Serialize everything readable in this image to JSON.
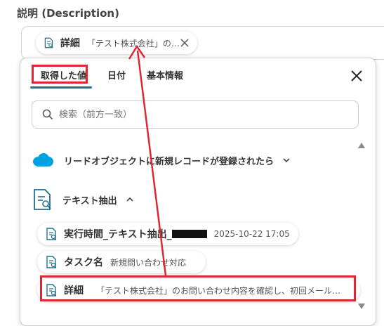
{
  "field": {
    "label": "説明 (Description)"
  },
  "selected_chip": {
    "label": "詳細",
    "value": "「テスト株式会社」の…",
    "icon": "text-extract-icon"
  },
  "panel": {
    "tabs": [
      {
        "label": "取得した値",
        "active": true
      },
      {
        "label": "日付",
        "active": false
      },
      {
        "label": "基本情報",
        "active": false
      }
    ],
    "search": {
      "placeholder": "検索（前方一致）"
    },
    "apps": [
      {
        "label": "リードオブジェクトに新規レコードが登録されたら",
        "icon": "salesforce-cloud-icon",
        "expanded": false
      },
      {
        "label": "テキスト抽出",
        "icon": "text-extract-icon",
        "expanded": true
      }
    ],
    "items": [
      {
        "label": "実行時間_テキスト抽出_",
        "value": "2025-10-22 17:05",
        "redacted": true
      },
      {
        "label": "タスク名",
        "value": "新規問い合わせ対応"
      },
      {
        "label": "詳細",
        "value": "「テスト株式会社」のお問い合わせ内容を確認し、初回メール…"
      }
    ]
  },
  "colors": {
    "accent": "#1f6f8b",
    "annotation_red": "#e02535",
    "salesforce_blue": "#00a1e0"
  }
}
